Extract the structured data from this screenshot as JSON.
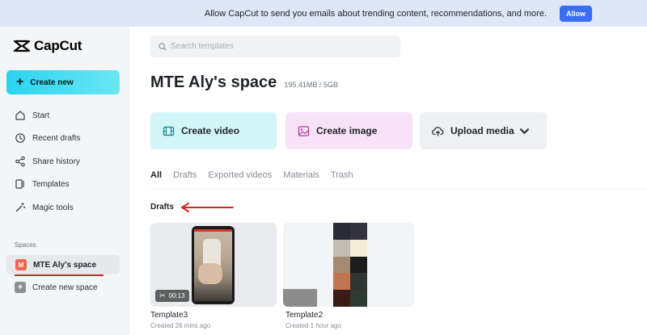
{
  "banner": {
    "message": "Allow CapCut to send you emails about trending content, recommendations, and more.",
    "allow_label": "Allow"
  },
  "sidebar": {
    "logo_text": "CapCut",
    "create_new_label": "Create new",
    "nav": [
      {
        "label": "Start",
        "icon": "home-icon"
      },
      {
        "label": "Recent drafts",
        "icon": "clock-icon"
      },
      {
        "label": "Share history",
        "icon": "share-icon"
      },
      {
        "label": "Templates",
        "icon": "templates-icon"
      },
      {
        "label": "Magic tools",
        "icon": "magic-wand-icon"
      }
    ],
    "spaces_label": "Spaces",
    "current_space": {
      "initial": "M",
      "label": "MTE Aly's space"
    },
    "new_space_label": "Create new space"
  },
  "main": {
    "search_placeholder": "Search templates",
    "space_title": "MTE Aly's space",
    "storage": "195.41MB / 5GB",
    "actions": {
      "create_video": "Create video",
      "create_image": "Create image",
      "upload_media": "Upload media"
    },
    "tabs": [
      "All",
      "Drafts",
      "Exported videos",
      "Materials",
      "Trash"
    ],
    "active_tab": "All",
    "section_title": "Drafts",
    "drafts": [
      {
        "name": "Template3",
        "created": "Created 26 mins ago",
        "duration": "00:13"
      },
      {
        "name": "Template2",
        "created": "Created 1 hour ago"
      }
    ]
  },
  "colors": {
    "accent_cyan": "#29d4ef",
    "allow_blue": "#3b6df5",
    "annotation_red": "#d32525",
    "avatar_orange": "#f0664a"
  }
}
